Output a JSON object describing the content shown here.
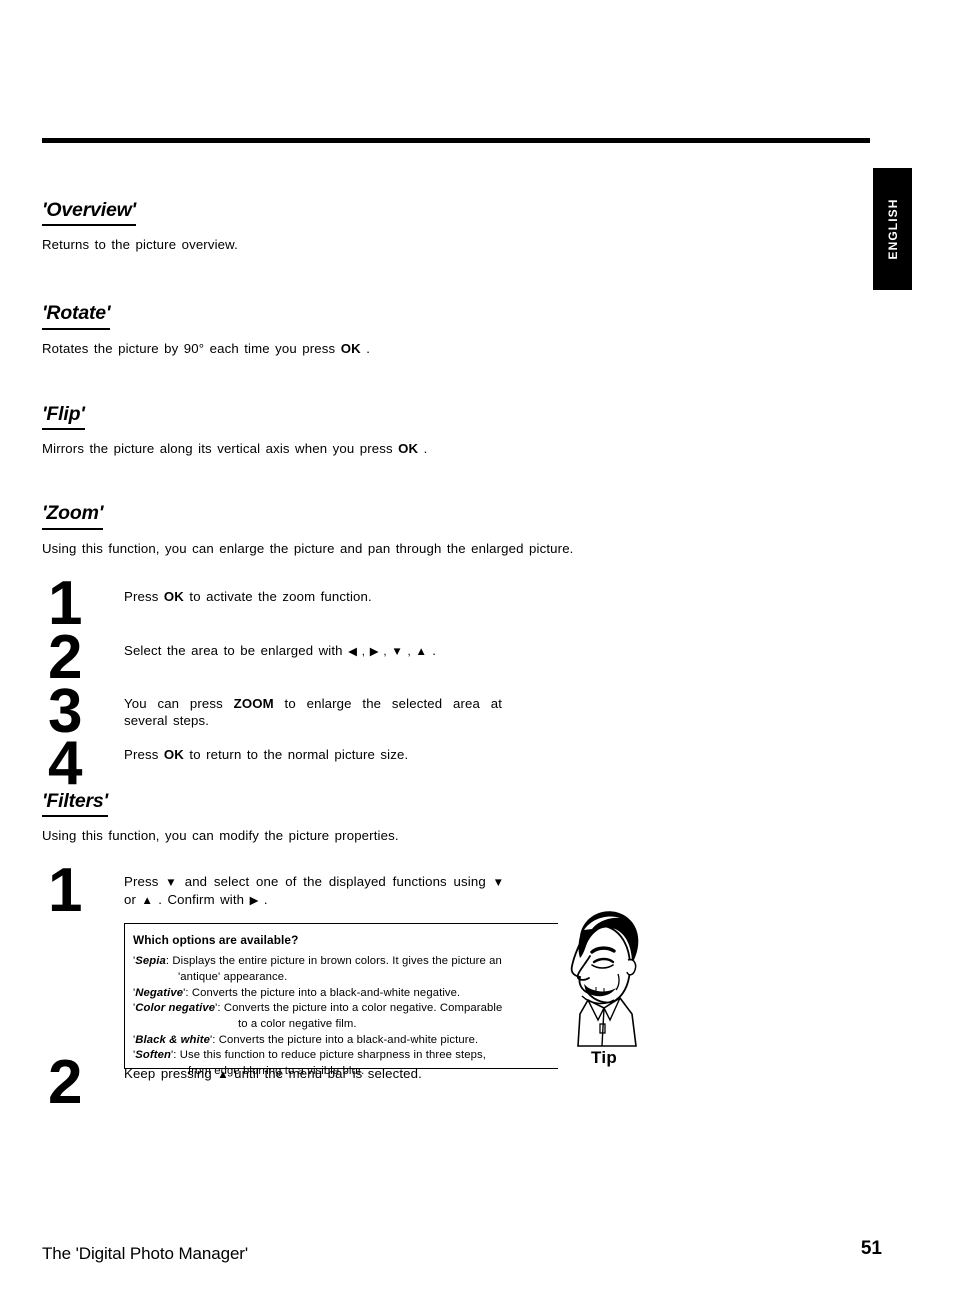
{
  "language_tab": {
    "label": "ENGLISH"
  },
  "sections": [
    {
      "heading": "'Overview'",
      "body": "Returns to the picture overview."
    },
    {
      "heading": "'Rotate'",
      "body_pre": "Rotates the picture by 90° each time you press ",
      "body_key": "OK",
      "body_post": " ."
    },
    {
      "heading": "'Flip'",
      "body_pre": "Mirrors the picture along its vertical axis when you press ",
      "body_key": "OK",
      "body_post": " ."
    },
    {
      "heading": "'Zoom'",
      "body": "Using this function, you can enlarge the picture and pan through the enlarged picture."
    },
    {
      "heading": "'Filters'",
      "body": "Using this function, you can modify the picture properties."
    }
  ],
  "zoom_steps": [
    {
      "num": "1",
      "pre": "Press ",
      "key": "OK",
      "post": " to activate the zoom function."
    },
    {
      "num": "2",
      "pre": "Select the area to be enlarged with ",
      "arrows": "◀ , ▶ , ▼ , ▲",
      "post": " ."
    },
    {
      "num": "3",
      "pre": "You can press ",
      "key": "ZOOM",
      "post": " to enlarge the selected area at several steps."
    },
    {
      "num": "4",
      "pre": "Press ",
      "key": "OK",
      "post": " to return to the normal picture size."
    }
  ],
  "filter_steps": [
    {
      "num": "1",
      "pre": "Press ",
      "a1": "▼",
      "mid": " and select one of the displayed functions using ",
      "a2": "▼",
      "mid2": " or ",
      "a3": "▲",
      "mid3": " . Confirm with ",
      "a4": "▶",
      "post": " ."
    },
    {
      "num": "2",
      "pre": "Keep pressing ",
      "a1": "▲",
      "post": " until the menu bar is selected."
    }
  ],
  "tip_box": {
    "title": "Which options are available?",
    "label": "Tip",
    "entries": [
      {
        "open_quote": "'",
        "term": "Sepia",
        "close": ": ",
        "text": "Displays the entire picture in brown colors. It gives the picture an",
        "cont": "'antique' appearance."
      },
      {
        "open_quote": "'",
        "term": "Negative",
        "close": "': ",
        "text": "Converts the picture into a black-and-white negative.",
        "cont": ""
      },
      {
        "open_quote": "'",
        "term": "Color negative",
        "close": "': ",
        "text": "Converts the picture into a color negative. Comparable",
        "cont": "to a color negative film."
      },
      {
        "open_quote": "'",
        "term": "Black & white",
        "close": "': ",
        "text": "Converts the picture into a black-and-white picture.",
        "cont": ""
      },
      {
        "open_quote": "'",
        "term": "Soften",
        "close": "': ",
        "text": "Use this function to reduce picture sharpness in three steps,",
        "cont": "from edge blurring to a visible blur."
      }
    ]
  },
  "footer": {
    "title": "The 'Digital Photo Manager'",
    "page": "51"
  },
  "colors": {
    "ink": "#000000",
    "paper": "#ffffff"
  }
}
